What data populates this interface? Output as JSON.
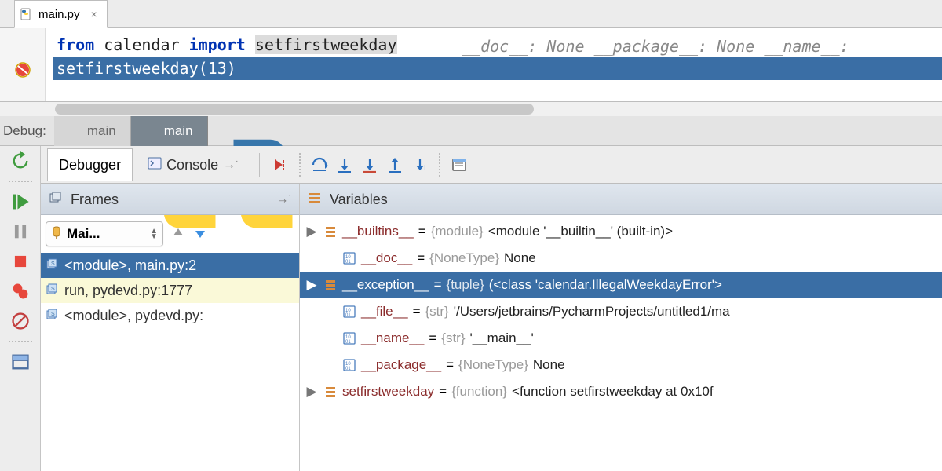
{
  "editor": {
    "tab_label": "main.py",
    "line1": {
      "kw_from": "from",
      "mod": "calendar",
      "kw_import": "import",
      "ident": "setfirstweekday",
      "inline_vars": "__doc__: None    __package__: None    __name__: "
    },
    "line2": "setfirstweekday(13)"
  },
  "debug_header": {
    "label": "Debug:",
    "configs": [
      "main",
      "main"
    ]
  },
  "tool_tabs": {
    "debugger": "Debugger",
    "console": "Console"
  },
  "frames": {
    "title": "Frames",
    "thread_dropdown": "Mai...",
    "items": [
      {
        "text": "<module>, main.py:2",
        "selected": true
      },
      {
        "text": "run, pydevd.py:1777",
        "yellow": true
      },
      {
        "text": "<module>, pydevd.py:",
        "yellow": false
      }
    ]
  },
  "variables": {
    "title": "Variables",
    "items": [
      {
        "expand": true,
        "icon": "list",
        "name": "__builtins__",
        "type": "{module}",
        "value": "<module '__builtin__' (built-in)>"
      },
      {
        "expand": false,
        "icon": "bin",
        "name": "__doc__",
        "type": "{NoneType}",
        "value": "None"
      },
      {
        "expand": true,
        "icon": "list",
        "name": "__exception__",
        "type": "{tuple}",
        "value": "(<class 'calendar.IllegalWeekdayError'>",
        "selected": true
      },
      {
        "expand": false,
        "icon": "bin",
        "name": "__file__",
        "type": "{str}",
        "value": "'/Users/jetbrains/PycharmProjects/untitled1/ma"
      },
      {
        "expand": false,
        "icon": "bin",
        "name": "__name__",
        "type": "{str}",
        "value": "'__main__'"
      },
      {
        "expand": false,
        "icon": "bin",
        "name": "__package__",
        "type": "{NoneType}",
        "value": "None"
      },
      {
        "expand": true,
        "icon": "list",
        "name": "setfirstweekday",
        "type": "{function}",
        "value": "<function setfirstweekday at 0x10f"
      }
    ]
  }
}
